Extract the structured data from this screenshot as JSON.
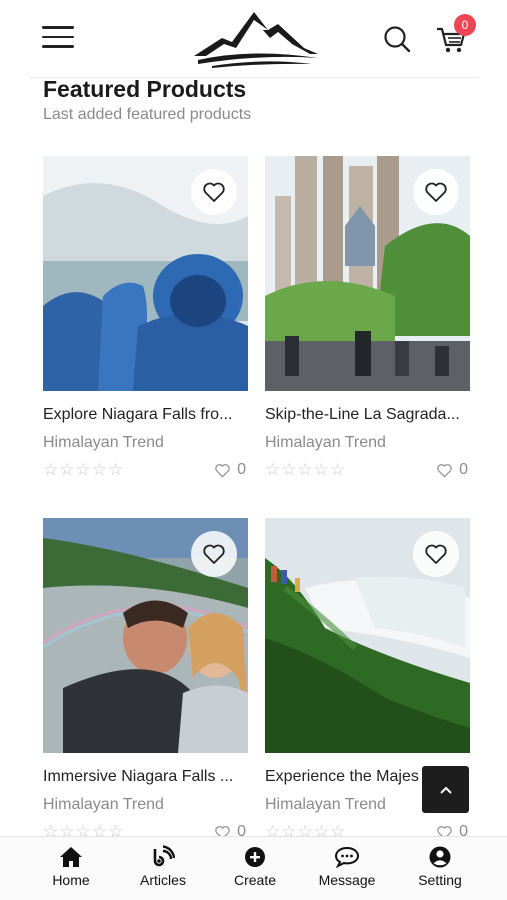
{
  "header": {
    "cart_count": "0"
  },
  "section": {
    "title": "Featured Products",
    "subtitle": "Last added featured products"
  },
  "products": [
    {
      "title": "Explore Niagara Falls fro...",
      "vendor": "Himalayan Trend",
      "rating": 0,
      "likes": "0"
    },
    {
      "title": "Skip-the-Line La Sagrada...",
      "vendor": "Himalayan Trend",
      "rating": 0,
      "likes": "0"
    },
    {
      "title": "Immersive Niagara Falls ...",
      "vendor": "Himalayan Trend",
      "rating": 0,
      "likes": "0"
    },
    {
      "title": "Experience the Majes",
      "vendor": "Himalayan Trend",
      "rating": 0,
      "likes": "0"
    }
  ],
  "nav": {
    "items": [
      {
        "label": "Home",
        "icon": "home-icon"
      },
      {
        "label": "Articles",
        "icon": "articles-icon"
      },
      {
        "label": "Create",
        "icon": "plus-circle-icon"
      },
      {
        "label": "Message",
        "icon": "chat-icon"
      },
      {
        "label": "Setting",
        "icon": "user-circle-icon"
      }
    ]
  },
  "colors": {
    "badge": "#ef4656",
    "back_to_top": "#1d1d1d"
  }
}
